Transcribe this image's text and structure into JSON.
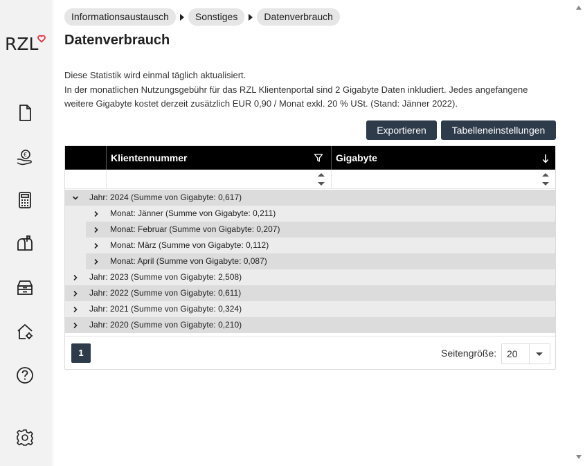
{
  "logo": {
    "text": "RZL"
  },
  "colors": {
    "accent": "#e3313f",
    "button": "#2e3b4b",
    "header": "#000000"
  },
  "sidebar": {
    "icons": [
      "document-icon",
      "money-hand-icon",
      "calculator-icon",
      "mailbox-icon",
      "archive-box-icon",
      "house-gear-icon",
      "help-icon",
      "settings-icon"
    ]
  },
  "breadcrumb": [
    "Informationsaustausch",
    "Sonstiges",
    "Datenverbrauch"
  ],
  "page": {
    "title": "Datenverbrauch",
    "desc_line1": "Diese Statistik wird einmal täglich aktualisiert.",
    "desc_line2": "In der monatlichen Nutzungsgebühr für das RZL Klientenportal sind 2 Gigabyte Daten inkludiert. Jedes angefangene weitere Gigabyte kostet derzeit zusätzlich EUR 0,90 / Monat exkl. 20 % USt. (Stand: Jänner 2022)."
  },
  "toolbar": {
    "export_label": "Exportieren",
    "settings_label": "Tabelleneinstellungen"
  },
  "grid": {
    "columns": [
      "Klientennummer",
      "Gigabyte"
    ],
    "rows": [
      {
        "label": "Jahr: 2024 (Summe von Gigabyte: 0,617)",
        "expanded": true
      },
      {
        "label": "Monat: Jänner (Summe von Gigabyte: 0,211)"
      },
      {
        "label": "Monat: Februar (Summe von Gigabyte: 0,207)"
      },
      {
        "label": "Monat: März (Summe von Gigabyte: 0,112)"
      },
      {
        "label": "Monat: April (Summe von Gigabyte: 0,087)"
      },
      {
        "label": "Jahr: 2023 (Summe von Gigabyte: 2,508)"
      },
      {
        "label": "Jahr: 2022 (Summe von Gigabyte: 0,611)"
      },
      {
        "label": "Jahr: 2021 (Summe von Gigabyte: 0,324)"
      },
      {
        "label": "Jahr: 2020 (Summe von Gigabyte: 0,210)"
      }
    ]
  },
  "pager": {
    "current_page": "1",
    "page_size_label": "Seitengröße:",
    "page_size": "20"
  }
}
